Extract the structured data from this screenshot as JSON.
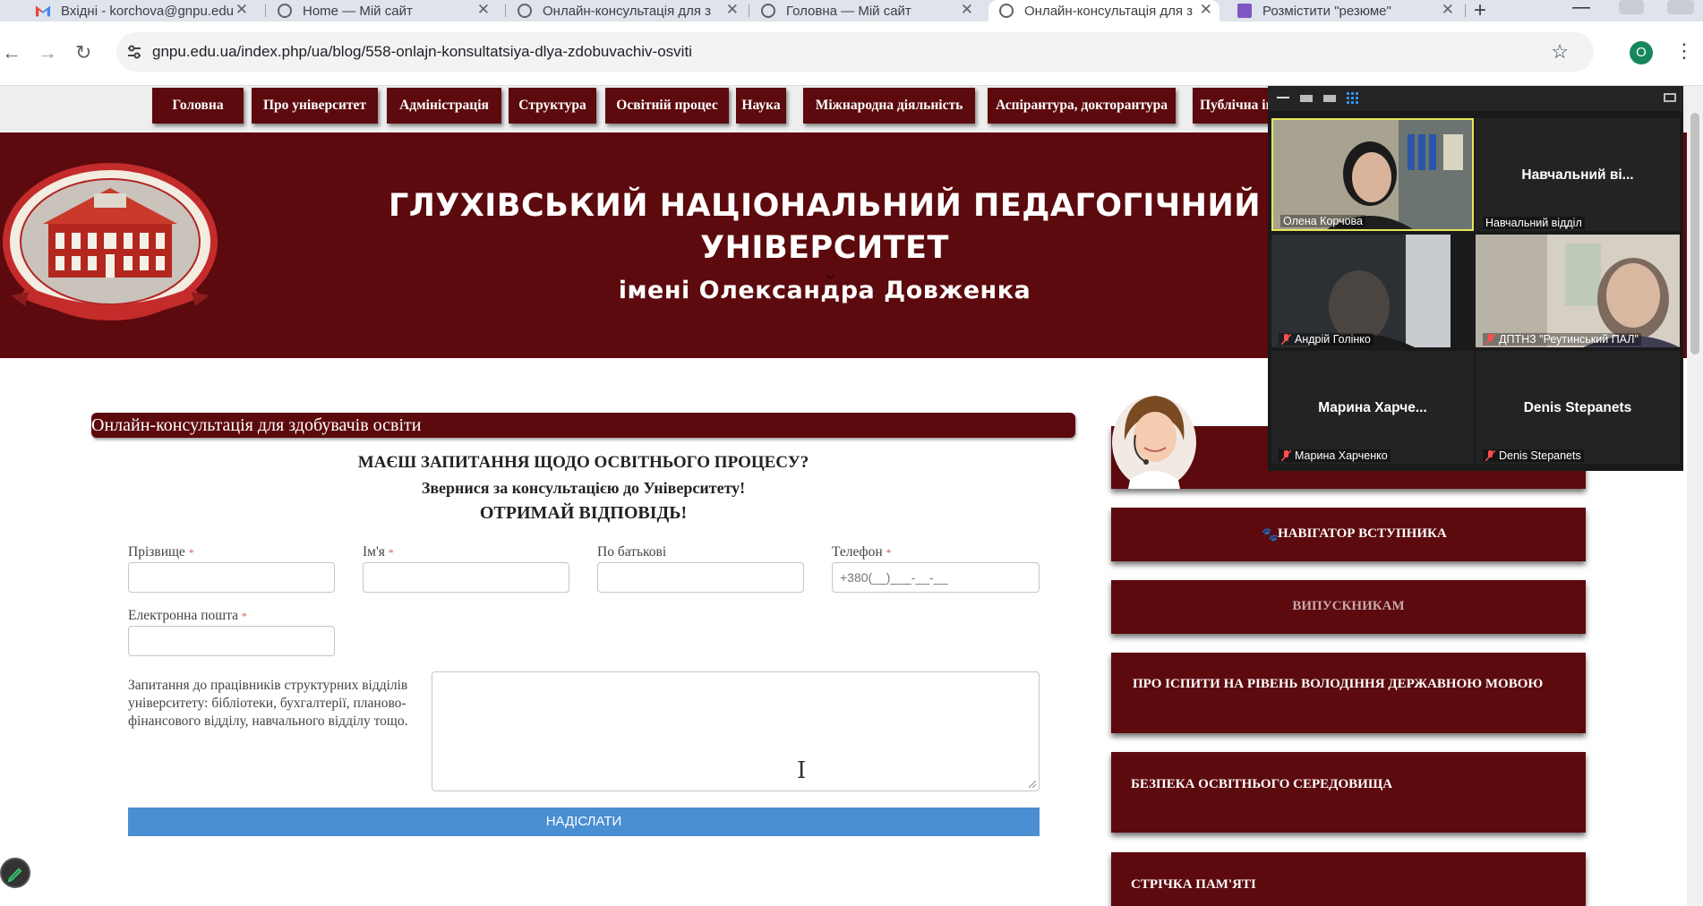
{
  "browser": {
    "tabs": [
      {
        "title": "Вхідні - korchova@gnpu.edu",
        "icon": "gmail-icon",
        "active": false
      },
      {
        "title": "Home — Мій сайт",
        "icon": "globe-icon",
        "active": false
      },
      {
        "title": "Онлайн-консультація для з",
        "icon": "globe-icon",
        "active": false
      },
      {
        "title": "Головна — Мій сайт",
        "icon": "globe-icon",
        "active": false
      },
      {
        "title": "Онлайн-консультація для з",
        "icon": "globe-icon",
        "active": true
      },
      {
        "title": "Розмістити \"резюме\"",
        "icon": "form-icon",
        "active": false
      }
    ],
    "close_glyph": "✕",
    "new_tab": "+",
    "url": "gnpu.edu.ua/index.php/ua/blog/558-onlajn-konsultatsiya-dlya-zdobuvachiv-osviti",
    "profile_initial": "O"
  },
  "site": {
    "menu": [
      "Головна",
      "Про університет",
      "Адміністрація",
      "Структура",
      "Освітній процес",
      "Наука",
      "Міжнародна діяльність",
      "Аспірантура, докторантура",
      "Публічна інформація"
    ],
    "header": {
      "line1": "ГЛУХІВСЬКИЙ НАЦІОНАЛЬНИЙ ПЕДАГОГІЧНИЙ",
      "line2": "УНІВЕРСИТЕТ",
      "line3": "імені Олександра Довженка"
    },
    "colors": {
      "brand": "#5c0a0d",
      "submit": "#4a8fd2"
    }
  },
  "form": {
    "title": "Онлайн-консультація для здобувачів освіти",
    "heading": "МАЄШ ЗАПИТАННЯ ЩОДО ОСВІТНЬОГО ПРОЦЕСУ?",
    "subheading": "Звернися за консультацією до Університету!",
    "cta": "ОТРИМАЙ ВІДПОВІДЬ!",
    "fields": {
      "surname": {
        "label": "Прізвище",
        "required": "*",
        "value": ""
      },
      "name": {
        "label": "Ім'я",
        "required": "*",
        "value": ""
      },
      "patronymic": {
        "label": "По батькові",
        "value": ""
      },
      "phone": {
        "label": "Телефон",
        "required": "*",
        "placeholder": "+380(__)___-__-__"
      },
      "email": {
        "label": "Електронна пошта",
        "required": "*",
        "value": ""
      }
    },
    "question_label": "Запитання до працівників структурних відділів університету: бібліотеки, бухгалтерії, планово-фінансового відділу, навчального відділу тощо.",
    "submit": "НАДІСЛАТИ"
  },
  "sidebar": {
    "cards": [
      "НАВІГАТОР ВСТУПНИКА",
      "ВИПУСКНИКАМ",
      "ПРО ІСПИТИ НА РІВЕНЬ ВОЛОДІННЯ ДЕРЖАВНОЮ МОВОЮ",
      "БЕЗПЕКА ОСВІТНЬОГО СЕРЕДОВИЩА",
      "СТРІЧКА ПАМ'ЯТІ"
    ]
  },
  "call": {
    "participants": [
      {
        "name": "Олена Корчова",
        "video": true,
        "muted": false,
        "active": true
      },
      {
        "name": "Навчальний відділ",
        "display": "Навчальний ві...",
        "video": false,
        "muted": false
      },
      {
        "name": "Андрій Голінко",
        "video": true,
        "muted": true
      },
      {
        "name": "ДПТНЗ \"Реутинський ПАЛ\"",
        "video": true,
        "muted": true
      },
      {
        "name": "Марина Харченко",
        "display": "Марина Харче...",
        "video": false,
        "muted": true
      },
      {
        "name": "Denis Stepanets",
        "display": "Denis Stepanets",
        "video": false,
        "muted": true
      }
    ]
  }
}
